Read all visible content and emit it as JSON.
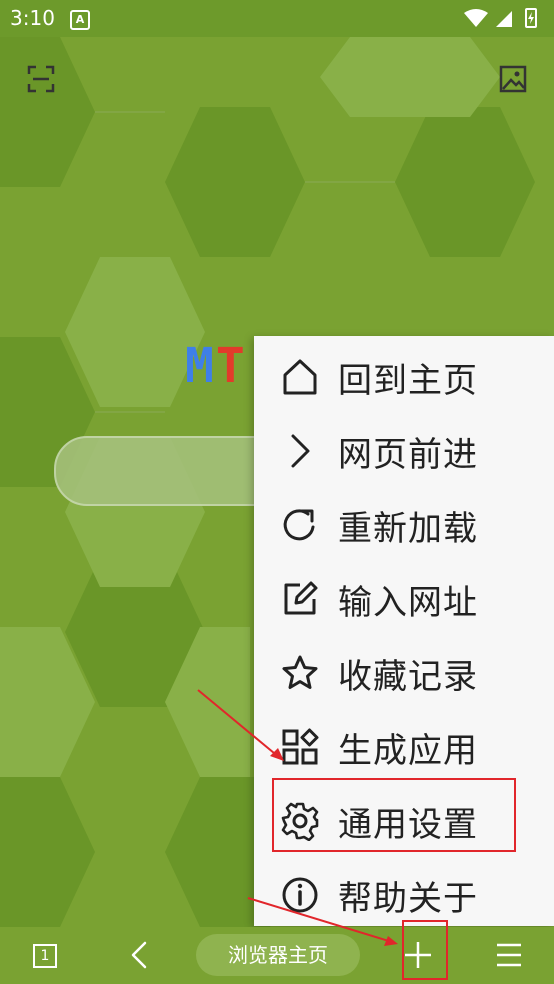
{
  "status_bar": {
    "time": "3:10",
    "notification_icon": "A"
  },
  "top_icons": {
    "left": "scan-icon",
    "right": "image-icon"
  },
  "logo": {
    "part1": "M",
    "part2": "T"
  },
  "menu": {
    "items": [
      {
        "label": "回到主页",
        "icon": "home-icon"
      },
      {
        "label": "网页前进",
        "icon": "forward-icon"
      },
      {
        "label": "重新加载",
        "icon": "reload-icon"
      },
      {
        "label": "输入网址",
        "icon": "edit-icon"
      },
      {
        "label": "收藏记录",
        "icon": "star-icon"
      },
      {
        "label": "生成应用",
        "icon": "apps-icon"
      },
      {
        "label": "通用设置",
        "icon": "gear-icon"
      },
      {
        "label": "帮助关于",
        "icon": "info-icon"
      }
    ]
  },
  "bottom_bar": {
    "tab_count": "1",
    "home_label": "浏览器主页"
  },
  "colors": {
    "accent_green": "#7aa232",
    "annotation_red": "#e1262b"
  }
}
